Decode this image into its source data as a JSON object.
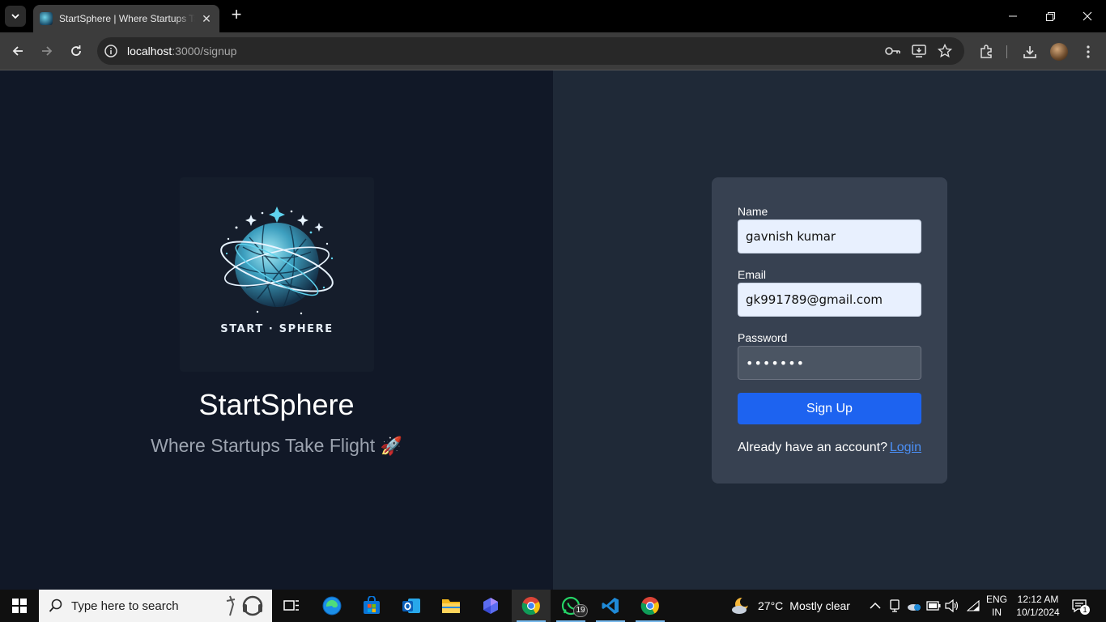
{
  "browser": {
    "tab_title": "StartSphere | Where Startups Take Flight",
    "url_host": "localhost",
    "url_path": ":3000/signup"
  },
  "brand": {
    "logo_text": "START · SPHERE",
    "name": "StartSphere",
    "tagline": "Where Startups Take Flight",
    "tagline_emoji": "🚀"
  },
  "form": {
    "name_label": "Name",
    "name_value": "gavnish kumar",
    "email_label": "Email",
    "email_value": "gk991789@gmail.com",
    "password_label": "Password",
    "password_value": "•••••••",
    "submit_label": "Sign Up",
    "login_prompt": "Already have an account?",
    "login_link": "Login"
  },
  "taskbar": {
    "search_placeholder": "Type here to search",
    "whatsapp_badge": "19",
    "weather_temp": "27°C",
    "weather_desc": "Mostly clear",
    "lang_line1": "ENG",
    "lang_line2": "IN",
    "time": "12:12 AM",
    "date": "10/1/2024",
    "notification_count": "1"
  },
  "colors": {
    "left_panel": "#111827",
    "right_panel": "#1f2937",
    "card": "#374151",
    "primary_button": "#1d63f0",
    "link": "#4b8ff5"
  }
}
